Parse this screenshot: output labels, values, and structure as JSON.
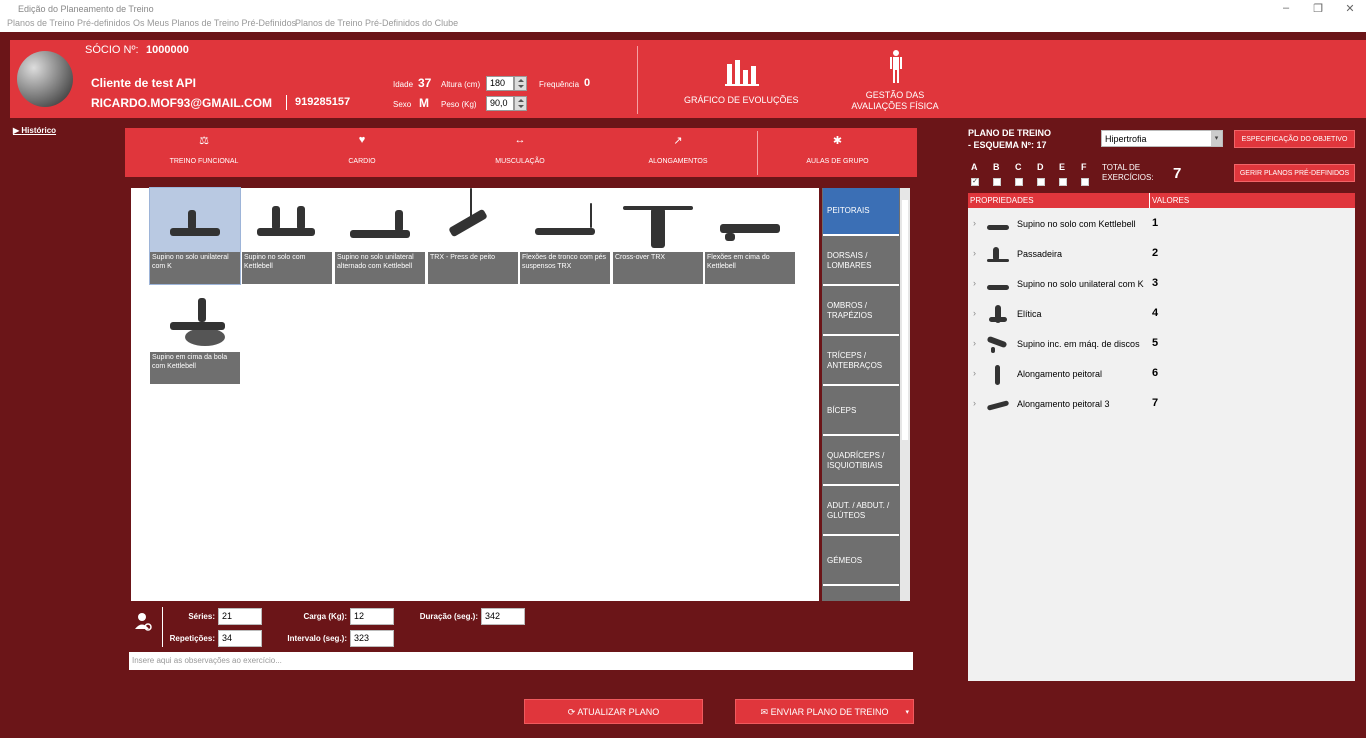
{
  "window": {
    "title": "Edição do Planeamento de Treino",
    "menu": [
      "Planos de Treino Pré-definidos",
      "Os Meus Planos de Treino Pré-Definidos",
      "Planos de Treino Pré-Definidos do Clube"
    ],
    "controls": [
      "–",
      "❐",
      "✕"
    ]
  },
  "member": {
    "socio_label": "SÓCIO Nº:",
    "socio_number": "1000000",
    "client_name": "Cliente de test API",
    "email": "RICARDO.MOF93@GMAIL.COM",
    "phone": "919285157",
    "idade_label": "Idade",
    "idade": "37",
    "altura_label": "Altura (cm)",
    "altura": "180",
    "frequencia_label": "Frequência",
    "frequencia": "0",
    "sexo_label": "Sexo",
    "sexo": "M",
    "peso_label": "Peso (Kg)",
    "peso": "90,0"
  },
  "header_actions": {
    "grafico": "GRÁFICO DE EVOLUÇÕES",
    "gestao": "GESTÃO DAS AVALIAÇÕES FÍSICA"
  },
  "historico": "Histórico",
  "categories": [
    "TREINO FUNCIONAL",
    "CARDIO",
    "MUSCULAÇÃO",
    "ALONGAMENTOS",
    "AULAS DE GRUPO"
  ],
  "exercises": [
    "Supino no solo unilateral com K",
    "Supino no solo com Kettlebell",
    "Supino no solo unilateral alternado com Kettlebell",
    "TRX - Press de peito",
    "Flexões de tronco com pés suspensos TRX",
    "Cross-over TRX",
    "Flexões em cima do Kettlebell",
    "Supino em cima da bola com Kettlebell"
  ],
  "muscles": [
    "PEITORAIS",
    "DORSAIS / LOMBARES",
    "OMBROS / TRAPÉZIOS",
    "TRÍCEPS / ANTEBRAÇOS",
    "BÍCEPS",
    "QUADRÍCEPS / ISQUIOTIBIAIS",
    "ADUT. / ABDUT. / GLÚTEOS",
    "GÉMEOS"
  ],
  "form": {
    "series_label": "Séries:",
    "series": "21",
    "repeticoes_label": "Repetições:",
    "repeticoes": "34",
    "carga_label": "Carga (Kg):",
    "carga": "12",
    "intervalo_label": "Intervalo (seg.):",
    "intervalo": "323",
    "duracao_label": "Duração (seg.):",
    "duracao": "342",
    "obs_placeholder": "Insere aqui as observações ao exercício..."
  },
  "buttons": {
    "atualizar": "ATUALIZAR PLANO",
    "enviar": "ENVIAR PLANO DE TREINO"
  },
  "plan": {
    "title_line1": "PLANO DE TREINO",
    "title_line2": "- ESQUEMA Nº: 17",
    "objective": "Hipertrofia",
    "spec_button": "ESPECIFICAÇÃO DO OBJETIVO",
    "gerir_button": "GERIR PLANOS PRÉ-DEFINIDOS",
    "letters": [
      "A",
      "B",
      "C",
      "D",
      "E",
      "F"
    ],
    "total_label": "TOTAL DE EXERCÍCIOS:",
    "total": "7",
    "col_props": "PROPRIEDADES",
    "col_values": "VALORES",
    "items": [
      {
        "name": "Supino no solo com Kettlebell",
        "value": "1"
      },
      {
        "name": "Passadeira",
        "value": "2"
      },
      {
        "name": "Supino no solo unilateral com K",
        "value": "3"
      },
      {
        "name": "Elítica",
        "value": "4"
      },
      {
        "name": "Supino inc. em máq. de discos",
        "value": "5"
      },
      {
        "name": "Alongamento peitoral",
        "value": "6"
      },
      {
        "name": "Alongamento peitoral 3",
        "value": "7"
      }
    ]
  },
  "colors": {
    "accent": "#e0363c",
    "background": "#6b1518",
    "selected_muscle": "#3b6fb5"
  }
}
